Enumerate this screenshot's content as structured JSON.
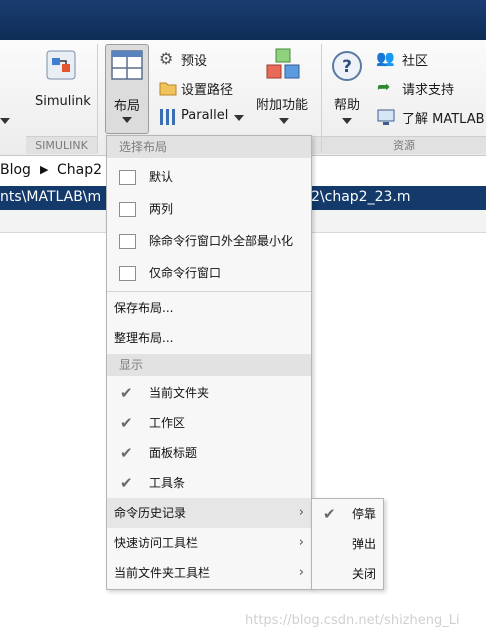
{
  "toolstrip": {
    "simulink": {
      "label": "Simulink"
    },
    "layout": {
      "label": "布局"
    },
    "preferences": {
      "label": "预设"
    },
    "set_path": {
      "label": "设置路径"
    },
    "parallel": {
      "label": "Parallel"
    },
    "addons": {
      "label": "附加功能"
    },
    "help": {
      "label": "帮助"
    },
    "community": {
      "label": "社区"
    },
    "request_support": {
      "label": "请求支持"
    },
    "learn_matlab": {
      "label": "了解 MATLAB"
    },
    "sections": {
      "simulink": "SIMULINK",
      "resources": "资源"
    }
  },
  "breadcrumb": {
    "part1": "Blog",
    "part2": "Chap2"
  },
  "path": {
    "left": "nts\\MATLAB\\m",
    "right": "2\\chap2_23.m"
  },
  "menu": {
    "header_layout": "选择布局",
    "layouts": [
      {
        "label": "默认"
      },
      {
        "label": "两列"
      },
      {
        "label": "除命令行窗口外全部最小化"
      },
      {
        "label": "仅命令行窗口"
      }
    ],
    "save_layout": "保存布局...",
    "organize_layout": "整理布局...",
    "header_show": "显示",
    "show_items": [
      {
        "label": "当前文件夹",
        "checked": true
      },
      {
        "label": "工作区",
        "checked": true
      },
      {
        "label": "面板标题",
        "checked": true
      },
      {
        "label": "工具条",
        "checked": true
      }
    ],
    "submenus": [
      {
        "label": "命令历史记录"
      },
      {
        "label": "快速访问工具栏"
      },
      {
        "label": "当前文件夹工具栏"
      }
    ]
  },
  "submenu": {
    "items": [
      {
        "label": "停靠",
        "checked": true
      },
      {
        "label": "弹出",
        "checked": false
      },
      {
        "label": "关闭",
        "checked": false
      }
    ]
  },
  "glyphs": {
    "check": "✔",
    "arrow": "›"
  },
  "watermark": "https://blog.csdn.net/shizheng_Li"
}
